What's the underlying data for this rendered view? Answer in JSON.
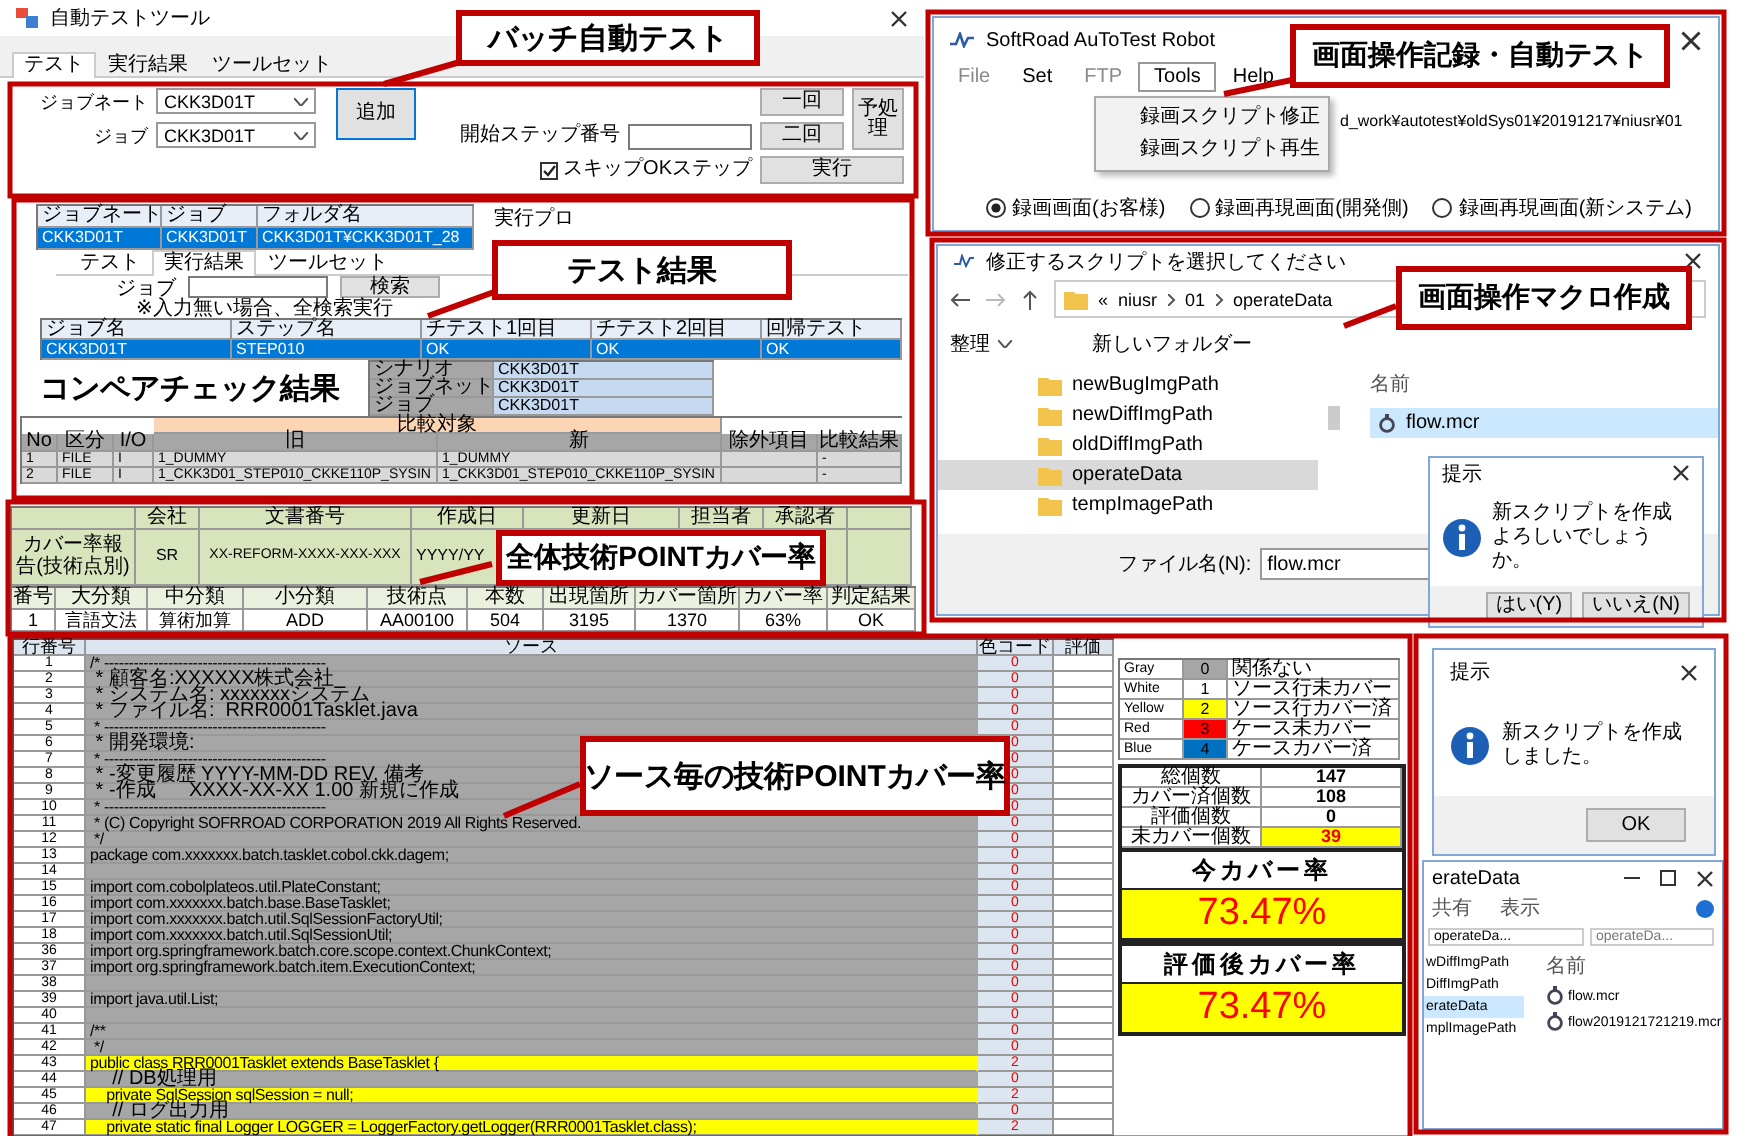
{
  "batch_tool": {
    "title": "自動テストツール",
    "tabs": [
      {
        "label": "テスト",
        "selected": true
      },
      {
        "label": "実行結果",
        "selected": false
      },
      {
        "label": "ツールセット",
        "selected": false
      }
    ],
    "fields": [
      {
        "label": "ジョブネート",
        "value": "CKK3D01T"
      },
      {
        "label": "ジョブ",
        "value": "CKK3D01T"
      }
    ],
    "add_button": "追加",
    "start_step_label": "開始ステップ番号",
    "once_button": "一回",
    "twice_button": "二回",
    "preprocess_button": "予処理",
    "skip_ok": {
      "label": "スキップOKステップ",
      "checked": true
    },
    "run_button": "実行",
    "callout": "バッチ自動テスト"
  },
  "test_results": {
    "grid": {
      "columns": [
        "ジョブネート",
        "ジョブ",
        "フォルダ名"
      ],
      "rows": [
        {
          "cells": [
            "CKK3D01T",
            "CKK3D01T",
            "CKK3D01T¥CKK3D01T_28"
          ],
          "selected": true
        }
      ]
    },
    "side_label": "実行プロ",
    "tabs": [
      {
        "label": "テスト",
        "selected": false
      },
      {
        "label": "実行結果",
        "selected": true
      },
      {
        "label": "ツールセット",
        "selected": false
      }
    ],
    "job_label": "ジョブ",
    "search_button": "検索",
    "note": "※入力無い場合、全検索実行",
    "table": {
      "columns": [
        "ジョブ名",
        "ステップ名",
        "チテスト1回目",
        "チテスト2回目",
        "回帰テスト"
      ],
      "rows": [
        {
          "cells": [
            "CKK3D01T",
            "STEP010",
            "OK",
            "OK",
            "OK"
          ],
          "selected": true
        }
      ]
    },
    "callout": "テスト結果"
  },
  "compare_check": {
    "title": "コンペアチェック結果",
    "info": [
      {
        "label": "シナリオ",
        "value": "CKK3D01T"
      },
      {
        "label": "ジョブネット",
        "value": "CKK3D01T"
      },
      {
        "label": "ジョブ",
        "value": "CKK3D01T"
      }
    ],
    "group_header": "比較対象",
    "columns": [
      "No",
      "区分",
      "I/O",
      "旧",
      "新",
      "除外項目",
      "比較結果"
    ],
    "rows": [
      {
        "no": "1",
        "kind": "FILE",
        "io": "I",
        "old": "1_DUMMY",
        "new": "1_DUMMY",
        "result": "-"
      },
      {
        "no": "2",
        "kind": "FILE",
        "io": "I",
        "old": "1_CKK3D01_STEP010_CKKE110P_SYSIN",
        "new": "1_CKK3D01_STEP010_CKKE110P_SYSIN",
        "result": "-"
      }
    ]
  },
  "coverage_report": {
    "header_columns": [
      "会社",
      "文書番号",
      "作成日",
      "更新日",
      "担当者",
      "承認者"
    ],
    "report_title": "カバー率報告(技術点別)",
    "company": "SR",
    "document_number": "XX-REFORM-XXXX-XXX-XXX",
    "created": "YYYY/YY",
    "columns": [
      "番号",
      "大分類",
      "中分類",
      "小分類",
      "技術点",
      "本数",
      "出現箇所",
      "カバー箇所",
      "カバー率",
      "判定結果"
    ],
    "rows": [
      {
        "cells": [
          "1",
          "言語文法",
          "算術加算",
          "ADD",
          "AA00100",
          "504",
          "3195",
          "1370",
          "63%",
          "OK"
        ]
      }
    ],
    "callout": "全体技術POINTカバー率"
  },
  "source_coverage": {
    "columns": [
      "行番号",
      "ソース",
      "色コード",
      "評価"
    ],
    "lines": [
      {
        "number": "1",
        "code": "/* ---------------------------------------------",
        "color_code": "0",
        "highlighted": false
      },
      {
        "number": "2",
        "code": " * 顧客名:XXXXXX株式会社",
        "color_code": "0",
        "highlighted": false
      },
      {
        "number": "3",
        "code": " * システム名: xxxxxxxシステム",
        "color_code": "0",
        "highlighted": false
      },
      {
        "number": "4",
        "code": " * ファイル名:  RRR0001Tasklet.java",
        "color_code": "0",
        "highlighted": false
      },
      {
        "number": "5",
        "code": " * ---------------------------------------------",
        "color_code": "0",
        "highlighted": false
      },
      {
        "number": "6",
        "code": " * 開発環境:",
        "color_code": "0",
        "highlighted": false
      },
      {
        "number": "7",
        "code": " * ---------------------------------------------",
        "color_code": "0",
        "highlighted": false
      },
      {
        "number": "8",
        "code": " * -変更履歴 YYYY-MM-DD REV. 備考",
        "color_code": "0",
        "highlighted": false
      },
      {
        "number": "9",
        "code": " * -作成      XXXX-XX-XX 1.00 新規に作成",
        "color_code": "0",
        "highlighted": false
      },
      {
        "number": "10",
        "code": " * ---------------------------------------------",
        "color_code": "0",
        "highlighted": false
      },
      {
        "number": "11",
        "code": " * (C) Copyright SOFRROAD CORPORATION 2019 All Rights Reserved.",
        "color_code": "0",
        "highlighted": false
      },
      {
        "number": "12",
        "code": " */",
        "color_code": "0",
        "highlighted": false
      },
      {
        "number": "13",
        "code": "package com.xxxxxxx.batch.tasklet.cobol.ckk.dagem;",
        "color_code": "0",
        "highlighted": false
      },
      {
        "number": "14",
        "color_code": "0",
        "highlighted": false
      },
      {
        "number": "15",
        "code": "import com.cobolplateos.util.PlateConstant;",
        "color_code": "0",
        "highlighted": false
      },
      {
        "number": "16",
        "code": "import com.xxxxxxx.batch.base.BaseTasklet;",
        "color_code": "0",
        "highlighted": false
      },
      {
        "number": "17",
        "code": "import com.xxxxxxx.batch.util.SqlSessionFactoryUtil;",
        "color_code": "0",
        "highlighted": false
      },
      {
        "number": "18",
        "code": "import com.xxxxxxx.batch.util.SqlSessionUtil;",
        "color_code": "0",
        "highlighted": false
      },
      {
        "number": "36",
        "code": "import org.springframework.batch.core.scope.context.ChunkContext;",
        "color_code": "0",
        "highlighted": false
      },
      {
        "number": "37",
        "code": "import org.springframework.batch.item.ExecutionContext;",
        "color_code": "0",
        "highlighted": false
      },
      {
        "number": "38",
        "color_code": "0",
        "highlighted": false
      },
      {
        "number": "39",
        "code": "import java.util.List;",
        "color_code": "0",
        "highlighted": false
      },
      {
        "number": "40",
        "color_code": "0",
        "highlighted": false
      },
      {
        "number": "41",
        "code": "/**",
        "color_code": "0",
        "highlighted": false
      },
      {
        "number": "42",
        "code": " */",
        "color_code": "0",
        "highlighted": false
      },
      {
        "number": "43",
        "code": "public class RRR0001Tasklet extends BaseTasklet {",
        "color_code": "2",
        "highlighted": true
      },
      {
        "number": "44",
        "code": "    // DB処理用",
        "color_code": "0",
        "highlighted": false
      },
      {
        "number": "45",
        "code": "    private SqlSession sqlSession = null;",
        "color_code": "2",
        "highlighted": true
      },
      {
        "number": "46",
        "code": "    // ログ出力用",
        "color_code": "0",
        "highlighted": false
      },
      {
        "number": "47",
        "code": "    private static final Logger LOGGER = LoggerFactory.getLogger(RRR0001Tasklet.class);",
        "color_code": "2",
        "highlighted": true
      }
    ],
    "legend": [
      {
        "name": "Gray",
        "code": "0",
        "meaning": "関係ない",
        "color": "#a6a6a6"
      },
      {
        "name": "White",
        "code": "1",
        "meaning": "ソース行未カバー",
        "color": "#ffffff"
      },
      {
        "name": "Yellow",
        "code": "2",
        "meaning": "ソース行カバー済",
        "color": "#ffff00"
      },
      {
        "name": "Red",
        "code": "3",
        "meaning": "ケース未カバー",
        "color": "#ff0000"
      },
      {
        "name": "Blue",
        "code": "4",
        "meaning": "ケースカバー済",
        "color": "#0070c0"
      }
    ],
    "stats": [
      {
        "label": "総個数",
        "value": "147",
        "highlighted": false
      },
      {
        "label": "カバー済個数",
        "value": "108",
        "highlighted": false
      },
      {
        "label": "評価個数",
        "value": "0",
        "highlighted": false
      },
      {
        "label": "未カバー個数",
        "value": "39",
        "highlighted": true
      }
    ],
    "current_rate": {
      "label": "今カバー率",
      "value": "73.47%"
    },
    "evaluated_rate": {
      "label": "評価後カバー率",
      "value": "73.47%"
    },
    "callout": "ソース毎の技術POINTカバー率"
  },
  "robot": {
    "title": "SoftRoad AuToTest Robot",
    "menu": [
      {
        "label": "File",
        "disabled": true,
        "selected": false
      },
      {
        "label": "Set",
        "disabled": false,
        "selected": false
      },
      {
        "label": "FTP",
        "disabled": true,
        "selected": false
      },
      {
        "label": "Tools",
        "disabled": false,
        "selected": true
      },
      {
        "label": "Help",
        "disabled": false,
        "selected": false
      }
    ],
    "dropdown": [
      "録画スクリプト修正",
      "録画スクリプト再生"
    ],
    "path": "d_work¥autotest¥oldSys01¥20191217¥niusr¥01",
    "modes": [
      {
        "label": "録画画面(お客様)",
        "selected": true
      },
      {
        "label": "録画再現画面(開発側)",
        "selected": false
      },
      {
        "label": "録画再現画面(新システム)",
        "selected": false
      }
    ],
    "callout": "画面操作記録・自動テスト"
  },
  "file_dialog": {
    "title": "修正するスクリプトを選択してください",
    "breadcrumb": [
      "«",
      "niusr",
      "01",
      "operateData"
    ],
    "organize_button": "整理",
    "new_folder_button": "新しいフォルダー",
    "folders": [
      {
        "name": "newBugImgPath",
        "selected": false
      },
      {
        "name": "newDiffImgPath",
        "selected": false
      },
      {
        "name": "oldDiffImgPath",
        "selected": false
      },
      {
        "name": "operateData",
        "selected": true
      },
      {
        "name": "tempImagePath",
        "selected": false
      }
    ],
    "name_column": "名前",
    "files": [
      {
        "name": "flow.mcr",
        "selected": true
      }
    ],
    "filename_label": "ファイル名(N):",
    "filename": "flow.mcr",
    "callout": "画面操作マクロ作成",
    "confirm": {
      "title": "提示",
      "message": "新スクリプトを作成よろしいでしょうか。",
      "buttons": [
        "はい(Y)",
        "いいえ(N)"
      ]
    }
  },
  "done_dialog": {
    "title": "提示",
    "message": "新スクリプトを作成しました。",
    "button": "OK"
  },
  "explorer": {
    "title": "erateData",
    "tabs": [
      "共有",
      "表示"
    ],
    "address": "operateDa...",
    "search_placeholder": "operateDa...",
    "folders": [
      {
        "name": "wDiffImgPath",
        "selected": false
      },
      {
        "name": "DiffImgPath",
        "selected": false
      },
      {
        "name": "erateData",
        "selected": true
      },
      {
        "name": "mplImagePath",
        "selected": false
      }
    ],
    "name_column": "名前",
    "files": [
      "flow.mcr",
      "flow2019121721219.mcr"
    ]
  }
}
